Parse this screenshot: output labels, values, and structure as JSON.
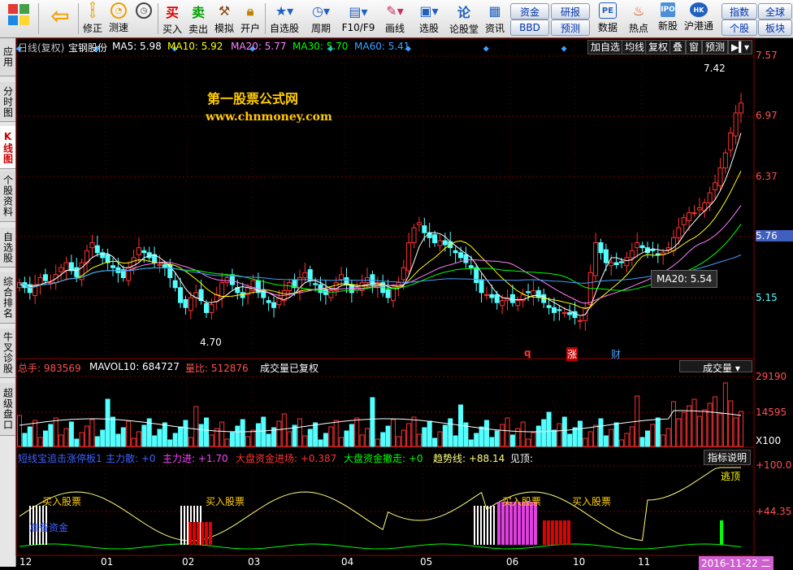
{
  "toolbar": {
    "buttons": [
      {
        "label": "修正",
        "icon": "up-down-arrows-icon"
      },
      {
        "label": "测速",
        "icon": "speed-gauge-icon"
      },
      {
        "label": "买入",
        "icon": "buy-icon"
      },
      {
        "label": "卖出",
        "icon": "sell-icon"
      },
      {
        "label": "模拟",
        "icon": "hammer-icon"
      },
      {
        "label": "开户",
        "icon": "lock-icon"
      },
      {
        "label": "自选股",
        "icon": "star-folder-icon"
      },
      {
        "label": "周期",
        "icon": "clock-icon"
      },
      {
        "label": "F10/F9",
        "icon": "f10-icon"
      },
      {
        "label": "画线",
        "icon": "pen-icon"
      },
      {
        "label": "选股",
        "icon": "screen-icon"
      },
      {
        "label": "论股堂",
        "icon": "forum-icon"
      },
      {
        "label": "资讯",
        "icon": "news-icon"
      },
      {
        "label": "数据",
        "icon": "pe-icon"
      },
      {
        "label": "热点",
        "icon": "hot-icon"
      },
      {
        "label": "新股",
        "icon": "ipo-icon"
      },
      {
        "label": "沪港通",
        "icon": "sse-hkex-icon"
      }
    ],
    "icon_glyphs": {
      "back": "⇦",
      "up": "⇧",
      "down": "⇩"
    },
    "pills": [
      "资金",
      "研报",
      "BBD",
      "预测",
      "指数",
      "全球",
      "个股",
      "板块"
    ]
  },
  "sidebar": {
    "tabs": [
      "应用",
      "分时图",
      "K线图",
      "个股资料",
      "自选股",
      "综合排名",
      "牛叉诊股",
      "超级盘口"
    ],
    "active": "K线图"
  },
  "price_header": {
    "period": "日线(复权)",
    "stock": "宝钢股份",
    "ma5": "MA5: 5.98",
    "ma10": "MA10: 5.92",
    "ma20": "MA20: 5.77",
    "ma30": "MA30: 5.70",
    "ma60": "MA60: 5.41"
  },
  "chart_buttons": [
    "加自选",
    "均线",
    "复权",
    "叠",
    "窗",
    "预测"
  ],
  "chart_button_icons": [
    "play-arrow-icon",
    "dropdown-icon"
  ],
  "watermark": {
    "title": "第一股票公式网",
    "url": "www.chnmoney.com"
  },
  "price_axis": [
    "7.57",
    "6.97",
    "6.37",
    "5.76",
    "5.15"
  ],
  "annotations": {
    "high": "7.42",
    "low": "4.70",
    "tooltip": "MA20: 5.54",
    "events": [
      "q",
      "涨",
      "财"
    ]
  },
  "volume_header": {
    "total": "总手: 983569",
    "mavol": "MAVOL10: 684727",
    "ratio": "量比: 512876",
    "note": "成交量已复权",
    "dropdown": "成交量"
  },
  "volume_axis": [
    "29190",
    "14595",
    "X100"
  ],
  "indicator_header": {
    "name": "短线宝追击涨停板1",
    "main_out": "主力散: +0",
    "main_in": "主力进: +1.70",
    "market_in": "大盘资金进场: +0.387",
    "market_out": "大盘资金撤走: +0",
    "trend": "趋势线: +88.14",
    "top": "见顶:",
    "explain": "指标说明"
  },
  "indicator_axis": [
    "+100.0",
    "+44.35"
  ],
  "indicator_labels": {
    "buy": "买入股票",
    "prep": "准备资金",
    "escape": "逃顶"
  },
  "x_axis": [
    "12",
    "01",
    "02",
    "03",
    "04",
    "05",
    "06",
    "10",
    "11"
  ],
  "date_badge": "2016-11-22 二",
  "colors": {
    "up": "#ff3232",
    "down": "#54ffff",
    "ma5": "#ffffff",
    "ma10": "#ffff00",
    "ma20": "#ff80ff",
    "ma30": "#00ff00",
    "ma60": "#40a0ff",
    "watermark": "#ffcc00"
  },
  "chart_data": {
    "type": "candlestick",
    "closes": [
      5.3,
      5.25,
      5.2,
      5.28,
      5.35,
      5.32,
      5.3,
      5.38,
      5.45,
      5.5,
      5.42,
      5.36,
      5.5,
      5.62,
      5.7,
      5.6,
      5.55,
      5.5,
      5.45,
      5.4,
      5.35,
      5.45,
      5.55,
      5.65,
      5.6,
      5.55,
      5.5,
      5.48,
      5.45,
      5.35,
      5.25,
      5.1,
      5.05,
      5.15,
      5.2,
      5.12,
      5.0,
      5.08,
      5.18,
      5.3,
      5.35,
      5.28,
      5.2,
      5.15,
      5.25,
      5.32,
      5.2,
      5.15,
      5.1,
      5.05,
      5.15,
      5.22,
      5.3,
      5.25,
      5.35,
      5.4,
      5.32,
      5.28,
      5.2,
      5.18,
      5.22,
      5.3,
      5.38,
      5.28,
      5.2,
      5.25,
      5.3,
      5.35,
      5.28,
      5.3,
      5.2,
      5.15,
      5.25,
      5.3,
      5.45,
      5.7,
      5.85,
      5.9,
      5.8,
      5.75,
      5.7,
      5.72,
      5.68,
      5.65,
      5.6,
      5.55,
      5.5,
      5.45,
      5.3,
      5.2,
      5.18,
      5.15,
      5.1,
      5.12,
      5.15,
      5.1,
      5.12,
      5.18,
      5.2,
      5.22,
      5.15,
      5.1,
      5.05,
      5.0,
      5.02,
      5.0,
      4.98,
      4.95,
      4.92,
      5.05,
      5.4,
      5.7,
      5.6,
      5.5,
      5.5,
      5.48,
      5.5,
      5.55,
      5.62,
      5.7,
      5.65,
      5.6,
      5.62,
      5.58,
      5.6,
      5.65,
      5.75,
      5.85,
      5.95,
      6.0,
      6.0,
      6.05,
      6.1,
      6.2,
      6.3,
      6.45,
      6.6,
      6.8,
      7.0,
      7.1
    ],
    "ma5": [
      5.28,
      5.27,
      5.26,
      5.27,
      5.28,
      5.3,
      5.31,
      5.34,
      5.38,
      5.42,
      5.43,
      5.42,
      5.45,
      5.5,
      5.55,
      5.58,
      5.59,
      5.59,
      5.56,
      5.5,
      5.45,
      5.45,
      5.47,
      5.5,
      5.55,
      5.57,
      5.58,
      5.55,
      5.51,
      5.46,
      5.4,
      5.32,
      5.24,
      5.18,
      5.15,
      5.13,
      5.1,
      5.1,
      5.11,
      5.14,
      5.18,
      5.22,
      5.25,
      5.26,
      5.25,
      5.24,
      5.22,
      5.21,
      5.2,
      5.17,
      5.14,
      5.13,
      5.15,
      5.19,
      5.25,
      5.3,
      5.32,
      5.32,
      5.3,
      5.27,
      5.24,
      5.24,
      5.27,
      5.28,
      5.27,
      5.26,
      5.27,
      5.28,
      5.29,
      5.29,
      5.28,
      5.26,
      5.24,
      5.24,
      5.27,
      5.37,
      5.51,
      5.66,
      5.75,
      5.8,
      5.8,
      5.79,
      5.76,
      5.71,
      5.67,
      5.63,
      5.59,
      5.55,
      5.48,
      5.4,
      5.33,
      5.26,
      5.19,
      5.15,
      5.14,
      5.13,
      5.13,
      5.13,
      5.15,
      5.17,
      5.17,
      5.16,
      5.13,
      5.1,
      5.07,
      5.04,
      5.02,
      4.99,
      4.97,
      4.98,
      5.06,
      5.2,
      5.33,
      5.45,
      5.55,
      5.55,
      5.53,
      5.52,
      5.53,
      5.57,
      5.6,
      5.62,
      5.64,
      5.63,
      5.62,
      5.62,
      5.65,
      5.7,
      5.78,
      5.85,
      5.91,
      5.97,
      6.02,
      6.07,
      6.13,
      6.22,
      6.33,
      6.47,
      6.63,
      6.8
    ]
  }
}
